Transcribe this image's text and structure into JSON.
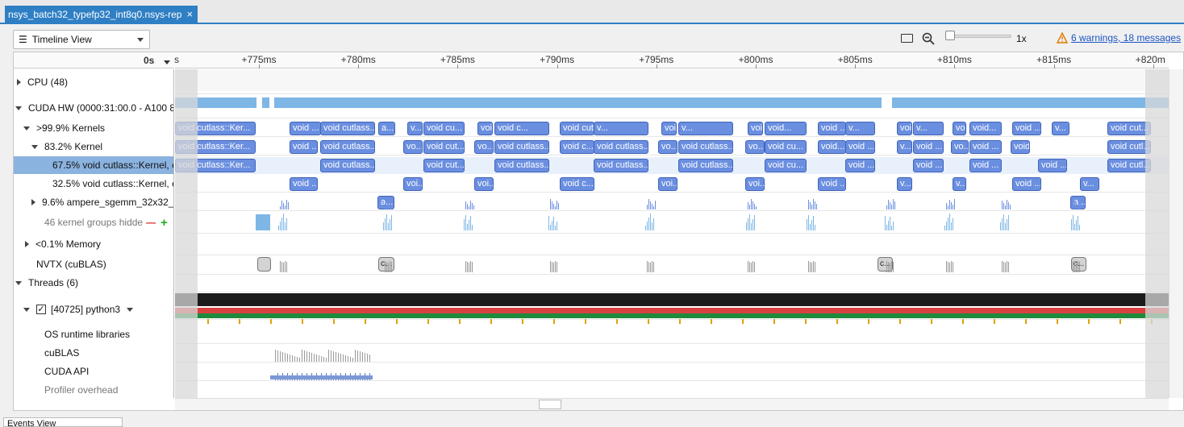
{
  "tab": {
    "title": "nsys_batch32_typefp32_int8q0.nsys-rep",
    "close": "×"
  },
  "toolbar": {
    "view_select": "Timeline View",
    "zoom_level": "1x",
    "warnings_link": "6 warnings, 18 messages"
  },
  "ruler": {
    "origin": "0s",
    "left_partial": "s",
    "ticks": [
      "+775ms",
      "+780ms",
      "+785ms",
      "+790ms",
      "+795ms",
      "+800ms",
      "+805ms",
      "+810ms",
      "+815ms",
      "+820m"
    ]
  },
  "rows": [
    {
      "label": "CPU (48)"
    },
    {
      "label": "CUDA HW (0000:31:00.0 - A100 8"
    },
    {
      "label": ">99.9% Kernels"
    },
    {
      "label": "83.2% Kernel"
    },
    {
      "label": "67.5% void cutlass::Kernel, c"
    },
    {
      "label": "32.5% void cutlass::Kernel, c"
    },
    {
      "label": "9.6% ampere_sgemm_32x32_"
    },
    {
      "label": "46 kernel groups hidde"
    },
    {
      "label": "<0.1% Memory"
    },
    {
      "label": "NVTX (cuBLAS)"
    },
    {
      "label": "Threads (6)"
    },
    {
      "label": "[40725] python3"
    },
    {
      "label": "OS runtime libraries"
    },
    {
      "label": "cuBLAS"
    },
    {
      "label": "CUDA API"
    },
    {
      "label": "Profiler overhead"
    }
  ],
  "hidden_group_minus": "—",
  "hidden_group_plus": "+",
  "thread_checkbox": "✓",
  "kernels": {
    "row_kernels": [
      "void cutlass::Ker...",
      "void ...",
      "void cutlass...",
      "a...",
      "v...",
      "void cu...",
      "void cutlass...",
      "void c...",
      "void cutlass...",
      "v...",
      "void cutlass...",
      "v...",
      "void cu...",
      "void...",
      "void ...",
      "v...",
      "void ...",
      "v...",
      "void ...",
      "void...",
      "void ...",
      "v...",
      "void cut..."
    ],
    "row_kernel": [
      "void cutlass::Ker...",
      "void ...",
      "void cutlass...",
      "vo...",
      "void cut...",
      "vo...",
      "void cutlass...",
      "void c...",
      "void cutlass...",
      "vo...",
      "void cutlass...",
      "vo...",
      "void cu...",
      "void...",
      "void ...",
      "v...",
      "void ...",
      "vo...",
      "void ...",
      "void...",
      "void cutl..."
    ],
    "row_67": [
      "void cutlass::Ker...",
      "void cutlass...",
      "void cut...",
      "void cutlass...",
      "void cutlass...",
      "void cutlass...",
      "void cu...",
      "void ...",
      "void ...",
      "void ...",
      "void ...",
      "void cutl..."
    ],
    "row_32": [
      "void ...",
      "voi...",
      "voi...",
      "void c...",
      "voi...",
      "voi...",
      "void ...",
      "v...",
      "v...",
      "void ...",
      "v..."
    ],
    "sgemm": [
      "a...",
      "a..."
    ],
    "nvtx": [
      "",
      "c...",
      "c...",
      "c..."
    ]
  },
  "bottom_tab": "Events View"
}
